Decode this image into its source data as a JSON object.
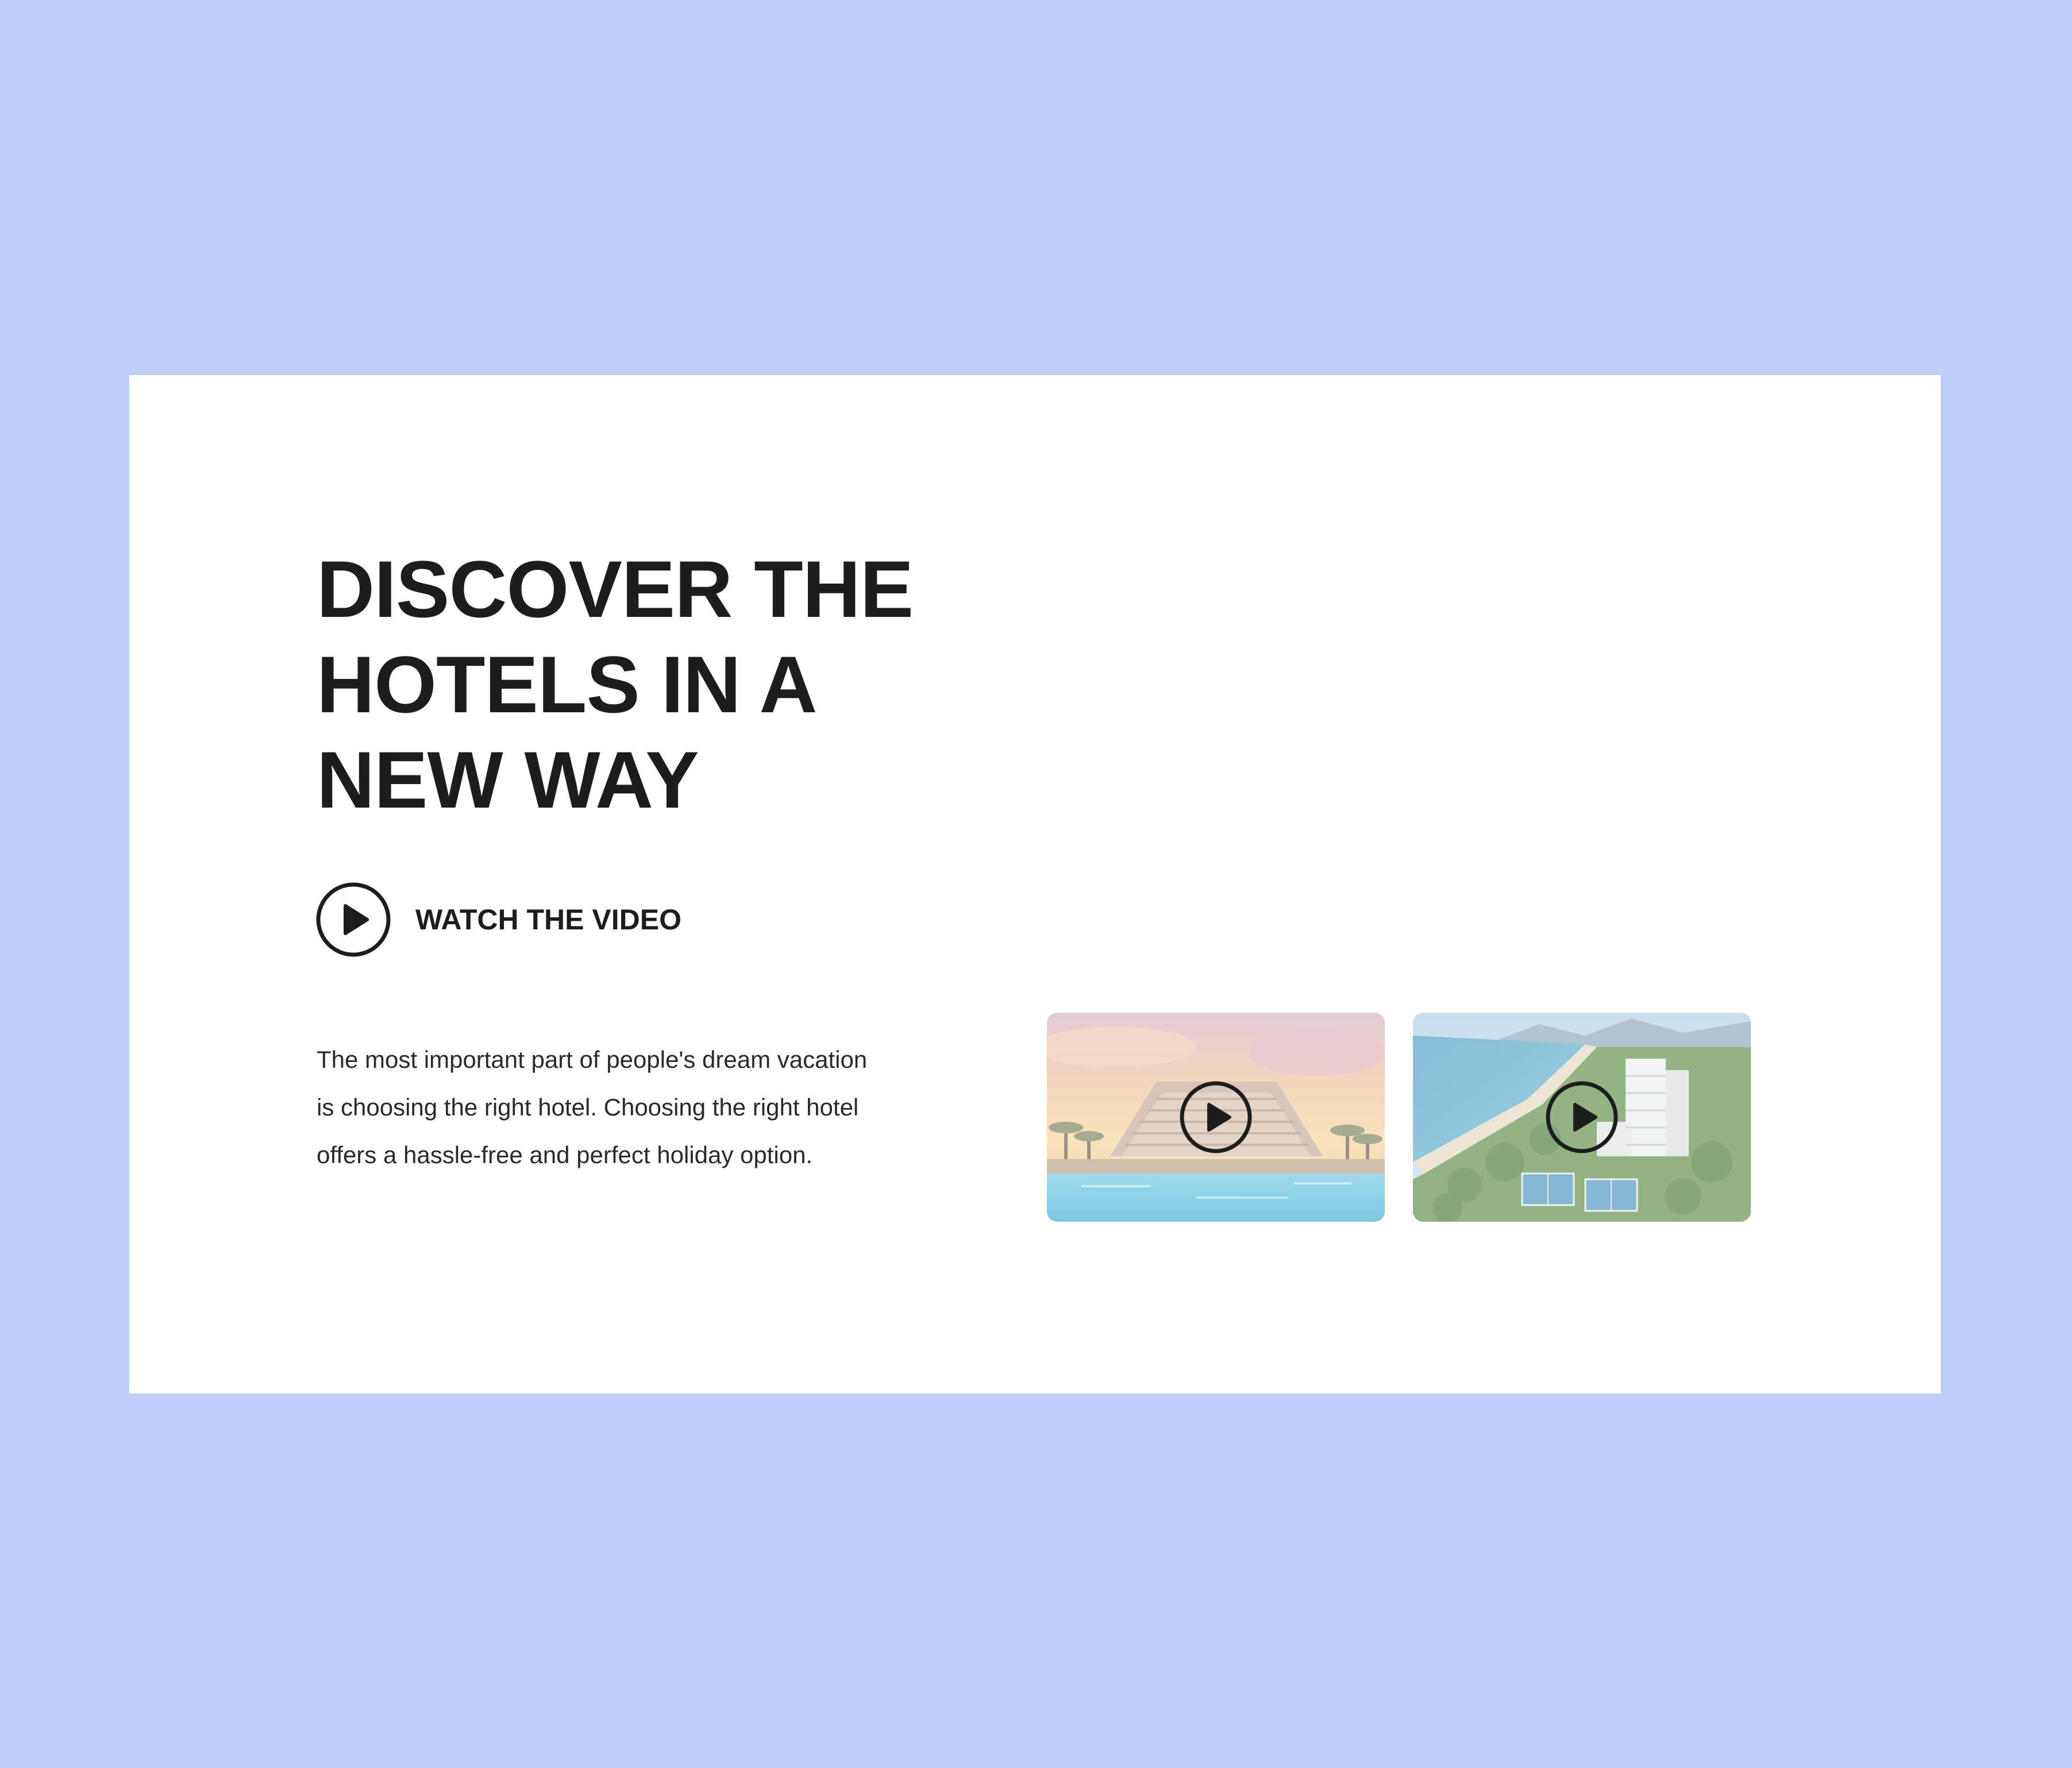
{
  "hero": {
    "headline_lines": [
      "DISCOVER THE",
      "HOTELS IN A",
      "NEW WAY"
    ],
    "watch_label": "WATCH THE VIDEO",
    "description_lines": [
      "The most important part of people's dream vacation",
      "is choosing the right hotel. Choosing the right hotel",
      "offers a hassle-free and perfect holiday option."
    ]
  },
  "videos": [
    {
      "subject": "resort-pool-sunset",
      "icon": "play-icon"
    },
    {
      "subject": "beachfront-hotel-aerial",
      "icon": "play-icon"
    }
  ],
  "colors": {
    "background": "#bfcdfb",
    "card": "#ffffff",
    "text": "#1d1d1d"
  }
}
